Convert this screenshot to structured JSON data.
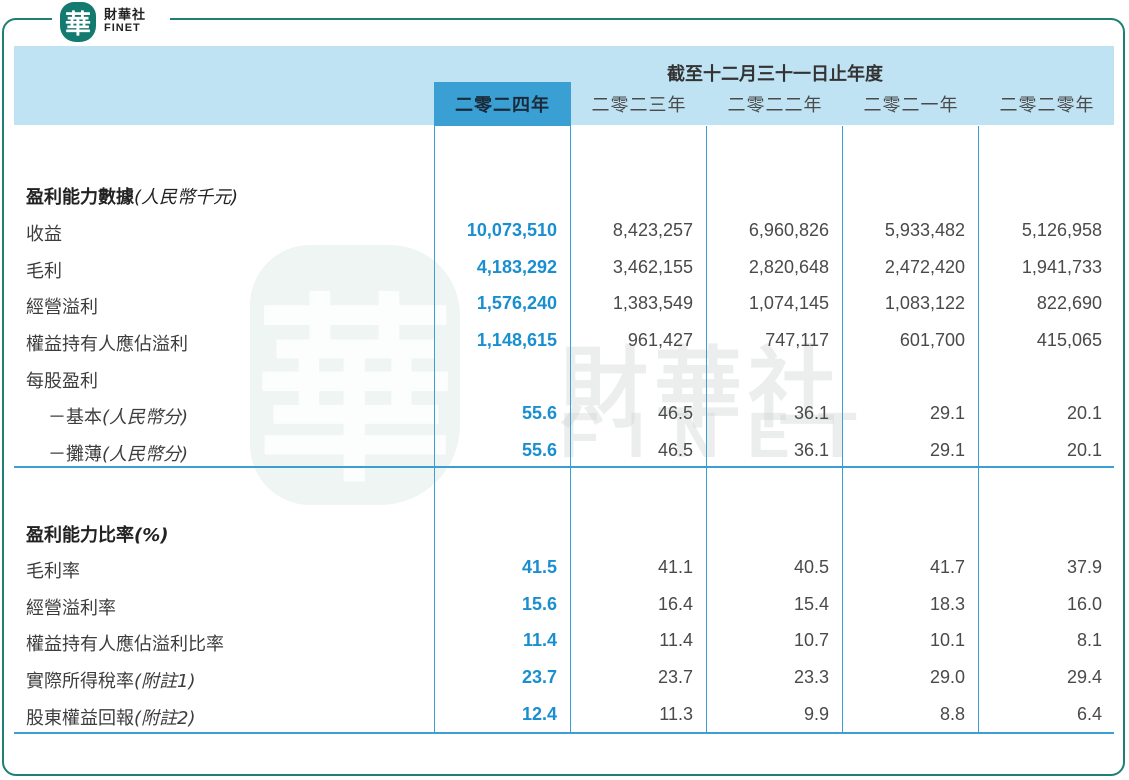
{
  "logo": {
    "mark": "華",
    "cn": "財華社",
    "en": "FINET"
  },
  "watermark": {
    "mark": "華",
    "cn": "財華社",
    "en": "FINET"
  },
  "header": {
    "period_title": "截至十二月三十一日止年度",
    "years": [
      "二零二四年",
      "二零二三年",
      "二零二二年",
      "二零二一年",
      "二零二零年"
    ]
  },
  "section1": {
    "title": "盈利能力數據",
    "unit": "(人民幣千元)",
    "rows": [
      {
        "label": "收益",
        "values": [
          "10,073,510",
          "8,423,257",
          "6,960,826",
          "5,933,482",
          "5,126,958"
        ]
      },
      {
        "label": "毛利",
        "values": [
          "4,183,292",
          "3,462,155",
          "2,820,648",
          "2,472,420",
          "1,941,733"
        ]
      },
      {
        "label": "經營溢利",
        "values": [
          "1,576,240",
          "1,383,549",
          "1,074,145",
          "1,083,122",
          "822,690"
        ]
      },
      {
        "label": "權益持有人應佔溢利",
        "values": [
          "1,148,615",
          "961,427",
          "747,117",
          "601,700",
          "415,065"
        ]
      },
      {
        "label": "每股盈利",
        "values": [
          "",
          "",
          "",
          "",
          ""
        ]
      },
      {
        "label": "－基本",
        "note": "(人民幣分)",
        "values": [
          "55.6",
          "46.5",
          "36.1",
          "29.1",
          "20.1"
        ]
      },
      {
        "label": "－攤薄",
        "note": "(人民幣分)",
        "values": [
          "55.6",
          "46.5",
          "36.1",
          "29.1",
          "20.1"
        ]
      }
    ]
  },
  "section2": {
    "title": "盈利能力比率",
    "unit": "(%)",
    "rows": [
      {
        "label": "毛利率",
        "values": [
          "41.5",
          "41.1",
          "40.5",
          "41.7",
          "37.9"
        ]
      },
      {
        "label": "經營溢利率",
        "values": [
          "15.6",
          "16.4",
          "15.4",
          "18.3",
          "16.0"
        ]
      },
      {
        "label": "權益持有人應佔溢利比率",
        "values": [
          "11.4",
          "11.4",
          "10.7",
          "10.1",
          "8.1"
        ]
      },
      {
        "label": "實際所得稅率",
        "note": "(附註1)",
        "values": [
          "23.7",
          "23.7",
          "23.3",
          "29.0",
          "29.4"
        ]
      },
      {
        "label": "股東權益回報",
        "note": "(附註2)",
        "values": [
          "12.4",
          "11.3",
          "9.9",
          "8.8",
          "6.4"
        ]
      }
    ]
  }
}
